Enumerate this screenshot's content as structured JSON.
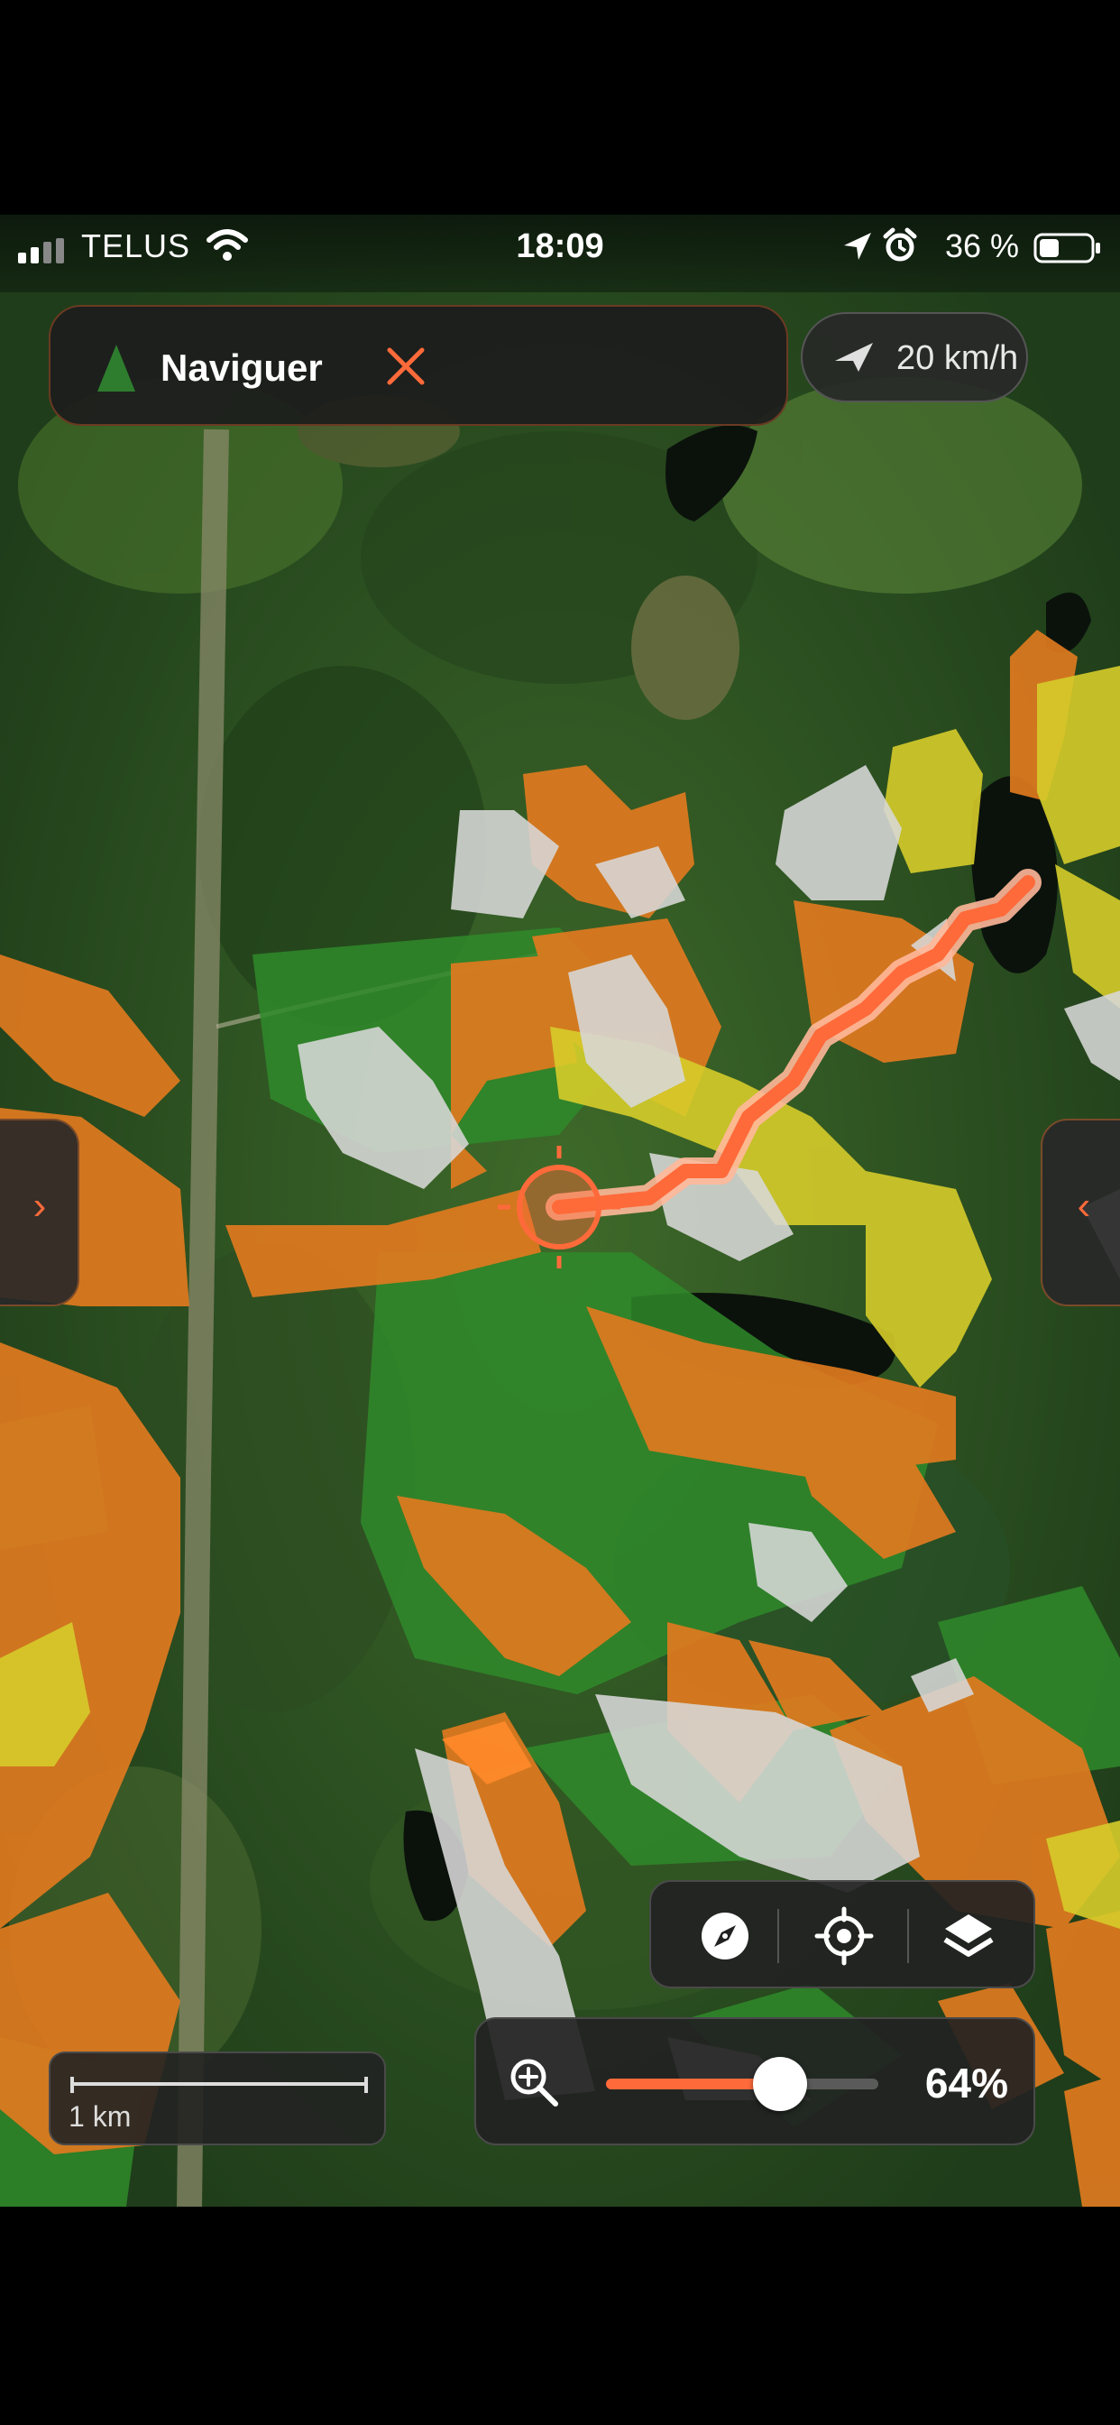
{
  "status_bar": {
    "carrier": "TELUS",
    "time": "18:09",
    "battery": "36 %",
    "icons": [
      "signal-icon",
      "wifi-icon",
      "location-arrow-icon",
      "alarm-icon",
      "battery-icon"
    ]
  },
  "navigation": {
    "label": "Naviguer",
    "icon": "tree-icon",
    "close_icon": "close-icon"
  },
  "speed": {
    "value": "20 km/h",
    "icon": "speed-arrow-icon"
  },
  "side_tabs": {
    "left": "›",
    "right": "‹"
  },
  "map_controls": {
    "buttons": [
      "compass-icon",
      "locate-icon",
      "layers-icon"
    ]
  },
  "zoom": {
    "icon": "zoom-in-icon",
    "percent_label": "64%",
    "level": 0.64
  },
  "scale": {
    "label": "1 km"
  },
  "colors": {
    "accent": "#ff6a3a",
    "harvest_orange": "#e07a1f",
    "yellow_zone": "#d6cc2a",
    "grey_zone": "#d8d8d8",
    "forest_green": "#2f6b25"
  }
}
